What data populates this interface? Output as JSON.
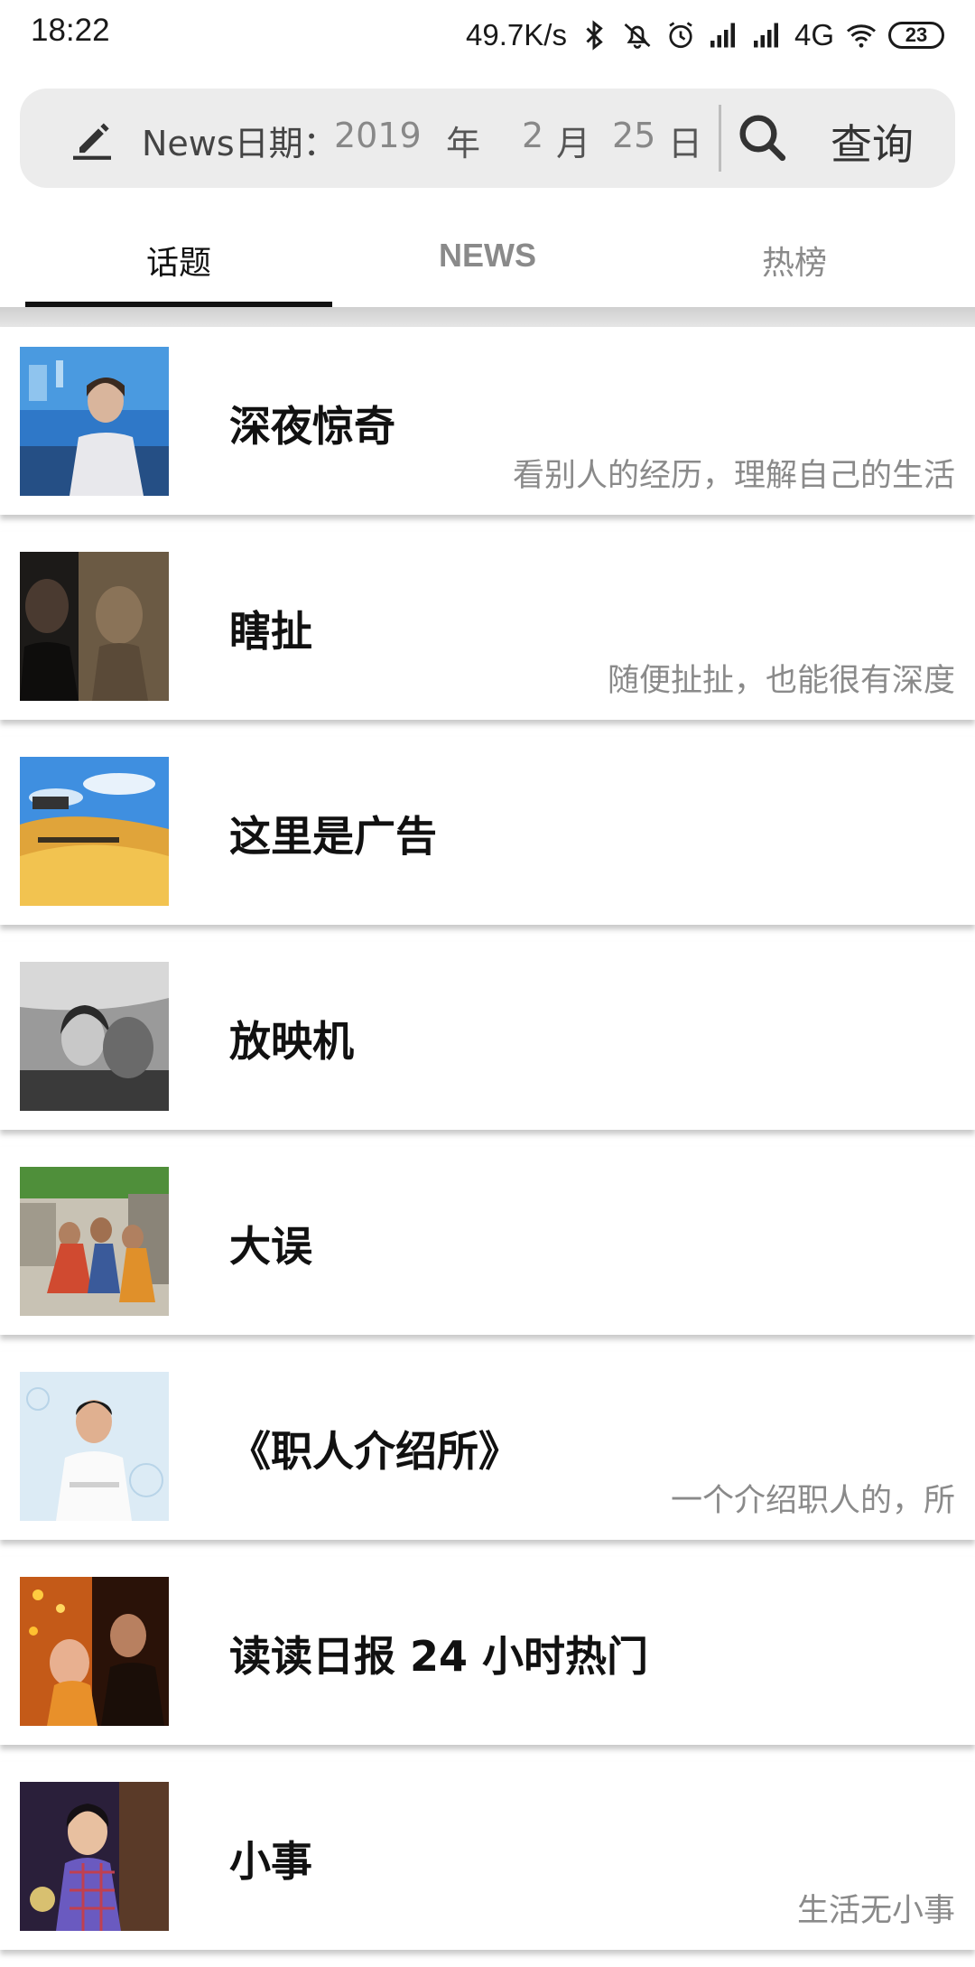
{
  "status_bar": {
    "time": "18:22",
    "net_speed": "49.7K/s",
    "network": "4G",
    "battery": "23",
    "icons": [
      "bluetooth-icon",
      "mute-icon",
      "alarm-icon",
      "signal-icon",
      "signal-icon",
      "wifi-icon",
      "battery-icon"
    ]
  },
  "query": {
    "label": "News日期：",
    "year": "2019",
    "year_unit": "年",
    "month": "2",
    "month_unit": "月",
    "day": "25",
    "day_unit": "日",
    "button": "查询"
  },
  "tabs": [
    {
      "label": "话题",
      "active": true
    },
    {
      "label": "NEWS",
      "active": false
    },
    {
      "label": "热榜",
      "active": false
    }
  ],
  "items": [
    {
      "title": "深夜惊奇",
      "subtitle": "看别人的经历，理解自己的生活"
    },
    {
      "title": "瞎扯",
      "subtitle": "随便扯扯，也能很有深度"
    },
    {
      "title": "这里是广告",
      "subtitle": ""
    },
    {
      "title": "放映机",
      "subtitle": ""
    },
    {
      "title": "大误",
      "subtitle": ""
    },
    {
      "title": "《职人介绍所》",
      "subtitle": "一个介绍职人的，所"
    },
    {
      "title": "读读日报 24 小时热门",
      "subtitle": ""
    },
    {
      "title": "小事",
      "subtitle": "生活无小事"
    }
  ]
}
